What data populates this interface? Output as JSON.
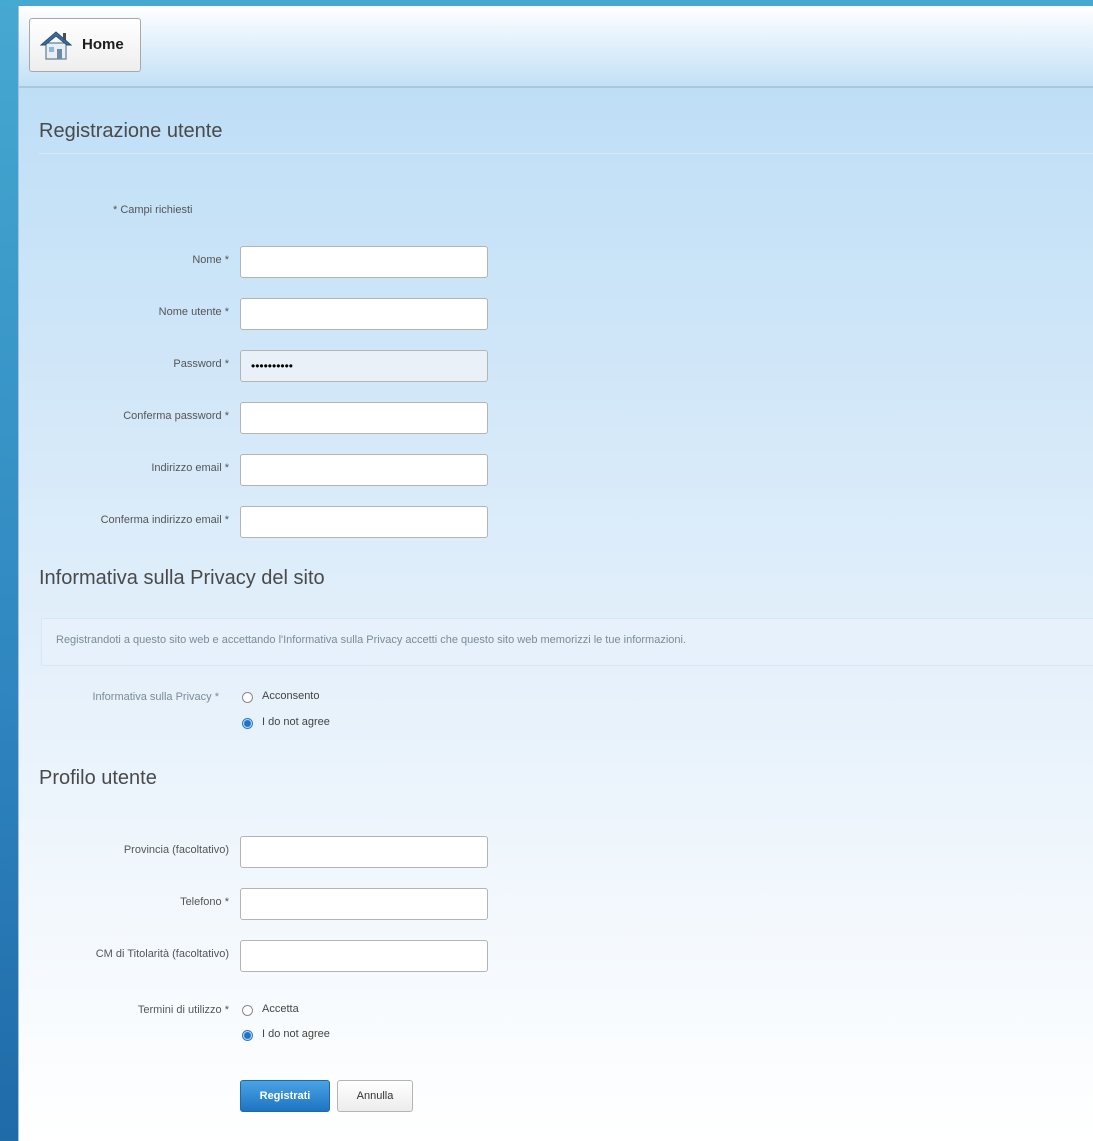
{
  "toolbar": {
    "home_label": "Home",
    "icon": "home-icon"
  },
  "registration": {
    "title": "Registrazione utente",
    "required_note": "* Campi richiesti",
    "fields": [
      {
        "label": "Nome *",
        "value": ""
      },
      {
        "label": "Nome utente *",
        "value": ""
      },
      {
        "label": "Password *",
        "value": "••••••••••"
      },
      {
        "label": "Conferma password *",
        "value": ""
      },
      {
        "label": "Indirizzo email *",
        "value": ""
      },
      {
        "label": "Conferma indirizzo email *",
        "value": ""
      }
    ]
  },
  "privacy": {
    "title": "Informativa sulla Privacy del sito",
    "notice": "Registrandoti a questo sito web e accettando l'Informativa sulla Privacy accetti che questo sito web memorizzi le tue informazioni.",
    "label": "Informativa sulla Privacy *",
    "options": [
      "Acconsento",
      "I do not agree"
    ],
    "selected": "I do not agree"
  },
  "profile": {
    "title": "Profilo utente",
    "fields": [
      {
        "label": "Provincia (facoltativo)",
        "value": ""
      },
      {
        "label": "Telefono *",
        "value": ""
      },
      {
        "label": "CM di Titolarità (facoltativo)",
        "value": ""
      }
    ],
    "terms_label": "Termini di utilizzo *",
    "terms_options": [
      "Accetta",
      "I do not agree"
    ],
    "terms_selected": "I do not agree"
  },
  "actions": {
    "register_label": "Registrati",
    "cancel_label": "Annulla"
  },
  "colors": {
    "accent": "#1e74c2",
    "outer_background": "#2f86c0",
    "frame_top": "#b9dcf6"
  }
}
